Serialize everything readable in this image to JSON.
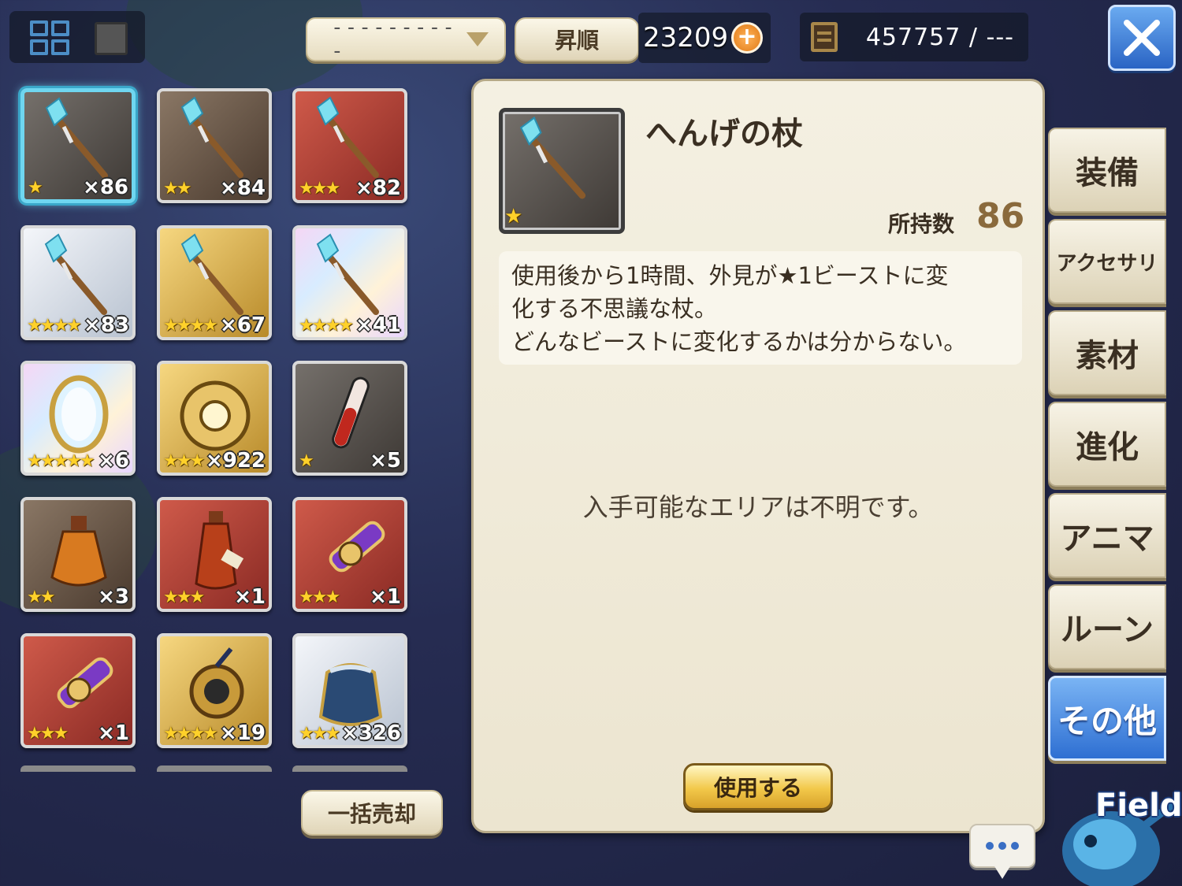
{
  "toolbar": {
    "sort_value": "----------",
    "order_label": "昇順",
    "currency_amount": "23209",
    "capacity_text": "457757 / ---"
  },
  "items": [
    {
      "stars": "★",
      "count": "×86",
      "rarity": "gray",
      "icon": "staff-icon",
      "selected": true
    },
    {
      "stars": "★★",
      "count": "×84",
      "rarity": "brown",
      "icon": "staff-icon"
    },
    {
      "stars": "★★★",
      "count": "×82",
      "rarity": "red",
      "icon": "staff-icon"
    },
    {
      "stars": "★★★★",
      "count": "×83",
      "rarity": "silver",
      "icon": "staff-icon"
    },
    {
      "stars": "★★★★",
      "count": "×67",
      "rarity": "gold",
      "icon": "staff-icon"
    },
    {
      "stars": "★★★★",
      "count": "×41",
      "rarity": "rainbow",
      "icon": "staff-icon"
    },
    {
      "stars": "★★★★★",
      "count": "×6",
      "rarity": "rainbow",
      "icon": "mirror-icon"
    },
    {
      "stars": "★★★",
      "count": "×922",
      "rarity": "gold",
      "icon": "orb-icon"
    },
    {
      "stars": "★",
      "count": "×5",
      "rarity": "gray",
      "icon": "vial-icon"
    },
    {
      "stars": "★★",
      "count": "×3",
      "rarity": "brown",
      "icon": "potion-icon"
    },
    {
      "stars": "★★★",
      "count": "×1",
      "rarity": "red",
      "icon": "potion-bottle-icon"
    },
    {
      "stars": "★★★",
      "count": "×1",
      "rarity": "red",
      "icon": "scroll-icon"
    },
    {
      "stars": "★★★",
      "count": "×1",
      "rarity": "red",
      "icon": "scroll-icon"
    },
    {
      "stars": "★★★★",
      "count": "×19",
      "rarity": "gold",
      "icon": "amulet-icon"
    },
    {
      "stars": "★★★",
      "count": "×326",
      "rarity": "silver",
      "icon": "pouch-icon"
    }
  ],
  "sell_all_label": "一括売却",
  "detail": {
    "stars": "★",
    "name": "へんげの杖",
    "owned_label": "所持数",
    "owned_value": "86",
    "description_lines": [
      "使用後から1時間、外見が★1ビーストに変",
      "化する不思議な杖。",
      "どんなビーストに変化するかは分からない。"
    ],
    "area_text": "入手可能なエリアは不明です。",
    "use_label": "使用する"
  },
  "categories": [
    {
      "label": "装備",
      "active": false
    },
    {
      "label": "アクセサリ",
      "active": false
    },
    {
      "label": "素材",
      "active": false
    },
    {
      "label": "進化",
      "active": false
    },
    {
      "label": "アニマ",
      "active": false
    },
    {
      "label": "ルーン",
      "active": false
    },
    {
      "label": "その他",
      "active": true
    }
  ],
  "field_label": "Field",
  "colors": {
    "accent_blue": "#2e6fd2",
    "selection_cyan": "#6fd6f0",
    "star_gold": "#ffd12a",
    "panel_bg": "#f4f0e2"
  }
}
